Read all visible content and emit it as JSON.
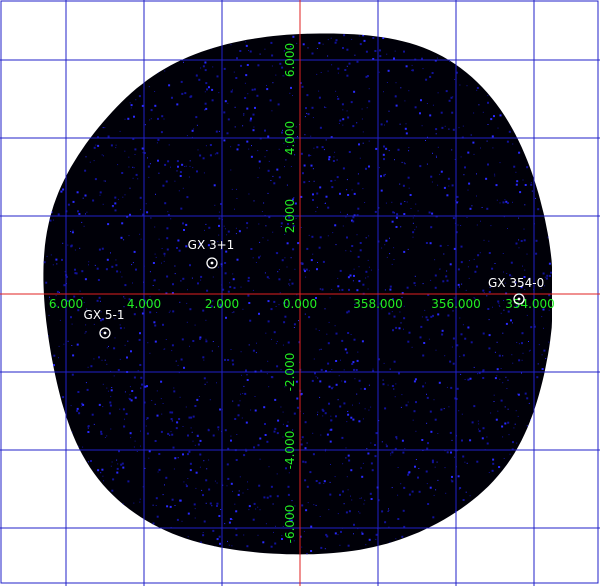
{
  "colors": {
    "background": "#ffffff",
    "sky_fill": "#000008",
    "grid": "#2020c8",
    "axes": "#e02020",
    "tick_labels": "#22ee22",
    "source_markers": "#ffffff",
    "noise": "#1a1acc"
  },
  "axes": {
    "longitude_labels": [
      "6.000",
      "4.000",
      "2.000",
      "0.000",
      "358.000",
      "356.000",
      "354.000"
    ],
    "latitude_labels": [
      "6.000",
      "4.000",
      "2.000",
      "-2.000",
      "-4.000",
      "-6.000"
    ]
  },
  "sources": [
    {
      "name": "GX 3+1"
    },
    {
      "name": "GX 5-1"
    },
    {
      "name": "GX 354-0"
    }
  ]
}
